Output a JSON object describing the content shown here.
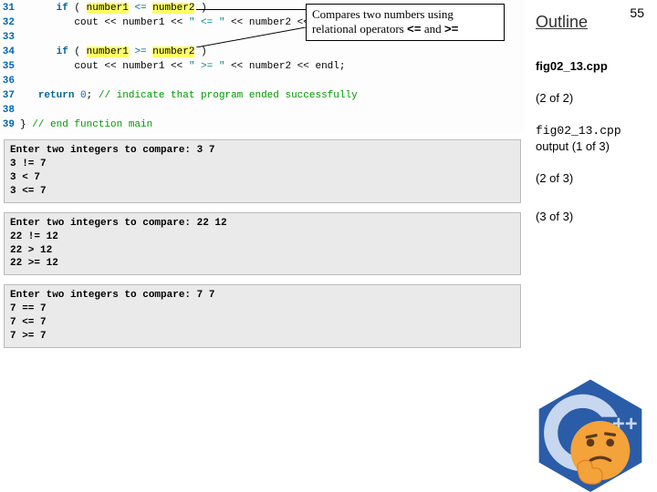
{
  "page_number": "55",
  "outline": {
    "title": "Outline",
    "items": [
      {
        "text": "fig02_13.cpp",
        "bold": true
      },
      {
        "text": "(2 of 2)"
      },
      {
        "mono": "fig02_13.cpp",
        "text2": "output  (1 of 3)"
      },
      {
        "text": "(2 of 3)"
      },
      {
        "text": "(3 of 3)"
      }
    ]
  },
  "callout": {
    "line1": "Compares two numbers using",
    "line2_a": "relational operators ",
    "sym1": "<=",
    "mid": " and ",
    "sym2": ">="
  },
  "code": {
    "lines": [
      {
        "n": "31",
        "ind": "      ",
        "a": "if",
        "b": " ( ",
        "h1": "number1",
        "c": " ",
        "op": "<=",
        "d": " ",
        "h2": "number2",
        "e": " )"
      },
      {
        "n": "32",
        "ind": "         ",
        "a": "cout << number1 << ",
        "s": "\" <= \"",
        "b": " << number2 << endl;"
      },
      {
        "n": "33",
        "ind": "",
        "blank": true
      },
      {
        "n": "34",
        "ind": "      ",
        "a": "if",
        "b": " ( ",
        "h1": "number1",
        "c": " ",
        "op": ">=",
        "d": " ",
        "h2": "number2",
        "e": " )"
      },
      {
        "n": "35",
        "ind": "         ",
        "a": "cout << number1 << ",
        "s": "\" >= \"",
        "b": " << number2 << endl;"
      },
      {
        "n": "36",
        "ind": "",
        "blank": true
      },
      {
        "n": "37",
        "ind": "   ",
        "a": "return",
        "b": " ",
        "num": "0",
        "c": "; ",
        "cmt": "// indicate that program ended successfully"
      },
      {
        "n": "38",
        "ind": "",
        "blank": true
      },
      {
        "n": "39",
        "ind": "",
        "a": "} ",
        "cmt": "// end function main"
      }
    ]
  },
  "outputs": [
    "Enter two integers to compare: 3 7\n3 != 7\n3 < 7\n3 <= 7",
    "Enter two integers to compare: 22 12\n22 != 12\n22 > 12\n22 >= 12",
    "Enter two integers to compare: 7 7\n7 == 7\n7 <= 7\n7 >= 7"
  ]
}
